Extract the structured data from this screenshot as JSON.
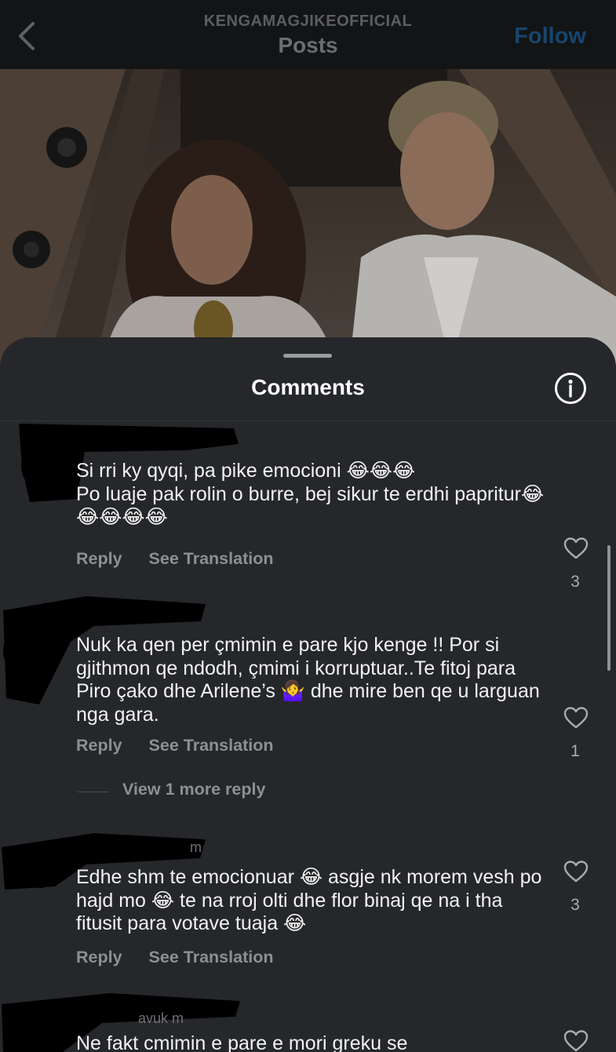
{
  "header": {
    "account_name": "KENGAMAGJIKEOFFICIAL",
    "title": "Posts",
    "follow_label": "Follow"
  },
  "sheet": {
    "title": "Comments"
  },
  "comments": [
    {
      "username": "",
      "lines": [
        "Si rri ky qyqi, pa pike emocioni 😂😂😂",
        "Po luaje pak rolin o burre, bej sikur te erdhi papritur😂😂😂😂😂"
      ],
      "reply_label": "Reply",
      "translate_label": "See Translation",
      "likes": "3"
    },
    {
      "username": "",
      "lines": [
        "Nuk ka qen per çmimin e pare kjo kenge !! Por si gjithmon qe ndodh, çmimi i korruptuar..Te fitoj para Piro çako dhe Arilene’s 🤷‍♀️ dhe mire ben qe u larguan nga gara."
      ],
      "reply_label": "Reply",
      "translate_label": "See Translation",
      "likes": "1",
      "view_replies_label": "View 1 more reply"
    },
    {
      "username": "m",
      "lines": [
        "Edhe shm te emocionuar 😂 asgje nk morem vesh po hajd mo 😂 te na rroj olti dhe flor binaj qe na i tha fitusit para votave tuaja 😂"
      ],
      "reply_label": "Reply",
      "translate_label": "See Translation",
      "likes": "3"
    },
    {
      "username": "avuk  m",
      "lines": [
        "Ne fakt cmimin e pare e mori greku se"
      ],
      "likes": ""
    }
  ],
  "icons": {
    "back": "chevron-left-icon",
    "info": "info-icon",
    "like": "heart-outline-icon"
  },
  "colors": {
    "sheet_background": "#25272a",
    "follow_dimmed": "#17456e",
    "secondary_text": "#8d8f93"
  }
}
